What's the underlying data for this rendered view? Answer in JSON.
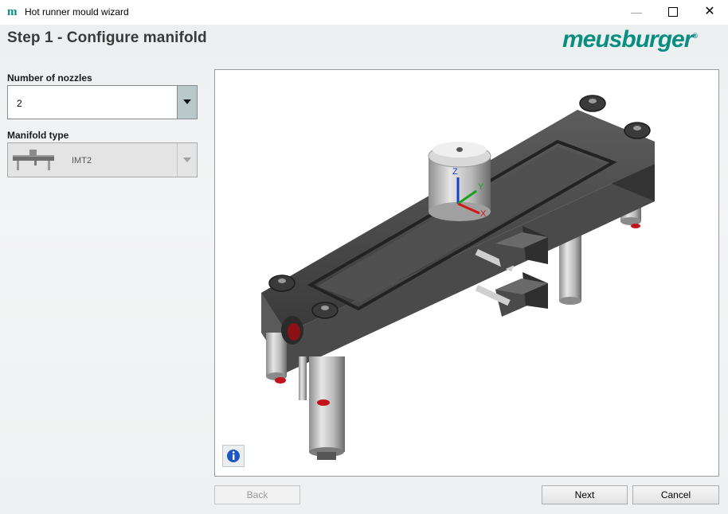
{
  "window": {
    "title": "Hot runner mould wizard",
    "app_icon_glyph": "m",
    "minimize_glyph": "—",
    "close_glyph": "✕"
  },
  "header": {
    "step_title": "Step 1 - Configure manifold",
    "brand": "meusburger",
    "brand_mark": "®",
    "brand_color": "#0a8e82"
  },
  "form": {
    "nozzles_label": "Number of nozzles",
    "nozzles_value": "2",
    "manifold_label": "Manifold type",
    "manifold_value": "IMT2"
  },
  "viewport": {
    "axis_labels": {
      "x": "X",
      "y": "Y",
      "z": "Z"
    },
    "info_icon": "info-icon"
  },
  "buttons": {
    "back": "Back",
    "next": "Next",
    "cancel": "Cancel"
  }
}
